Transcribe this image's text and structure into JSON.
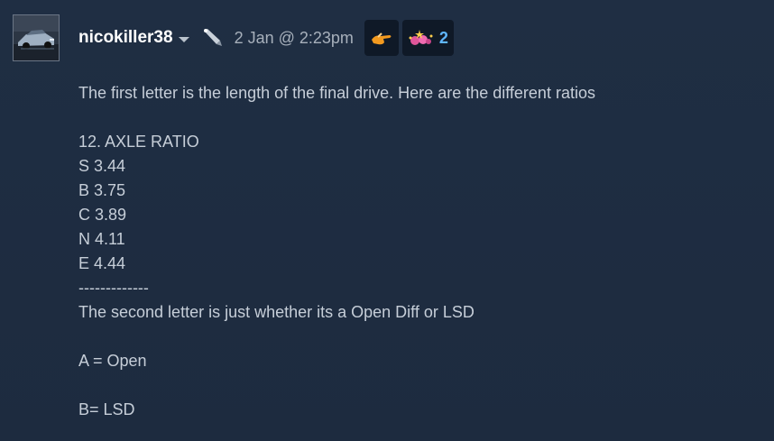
{
  "author": {
    "name": "nicokiller38"
  },
  "timestamp": "2 Jan @ 2:23pm",
  "icons": {
    "pen": "pen-icon",
    "award1": "pointing-hand-award-icon",
    "award2": "party-award-icon"
  },
  "awards": {
    "second_count": "2"
  },
  "colors": {
    "background": "#1e2c40",
    "text": "#c6ced8",
    "author": "#ffffff",
    "award_count": "#5fb6ff"
  },
  "body_lines": [
    "The first letter is the length of the final drive. Here are the different ratios",
    "",
    "12. AXLE RATIO",
    "S 3.44",
    "B 3.75",
    "C 3.89",
    "N 4.11",
    "E 4.44",
    "-------------",
    "The second letter is just whether its a Open Diff or LSD",
    "",
    "A = Open",
    "",
    "B= LSD"
  ]
}
